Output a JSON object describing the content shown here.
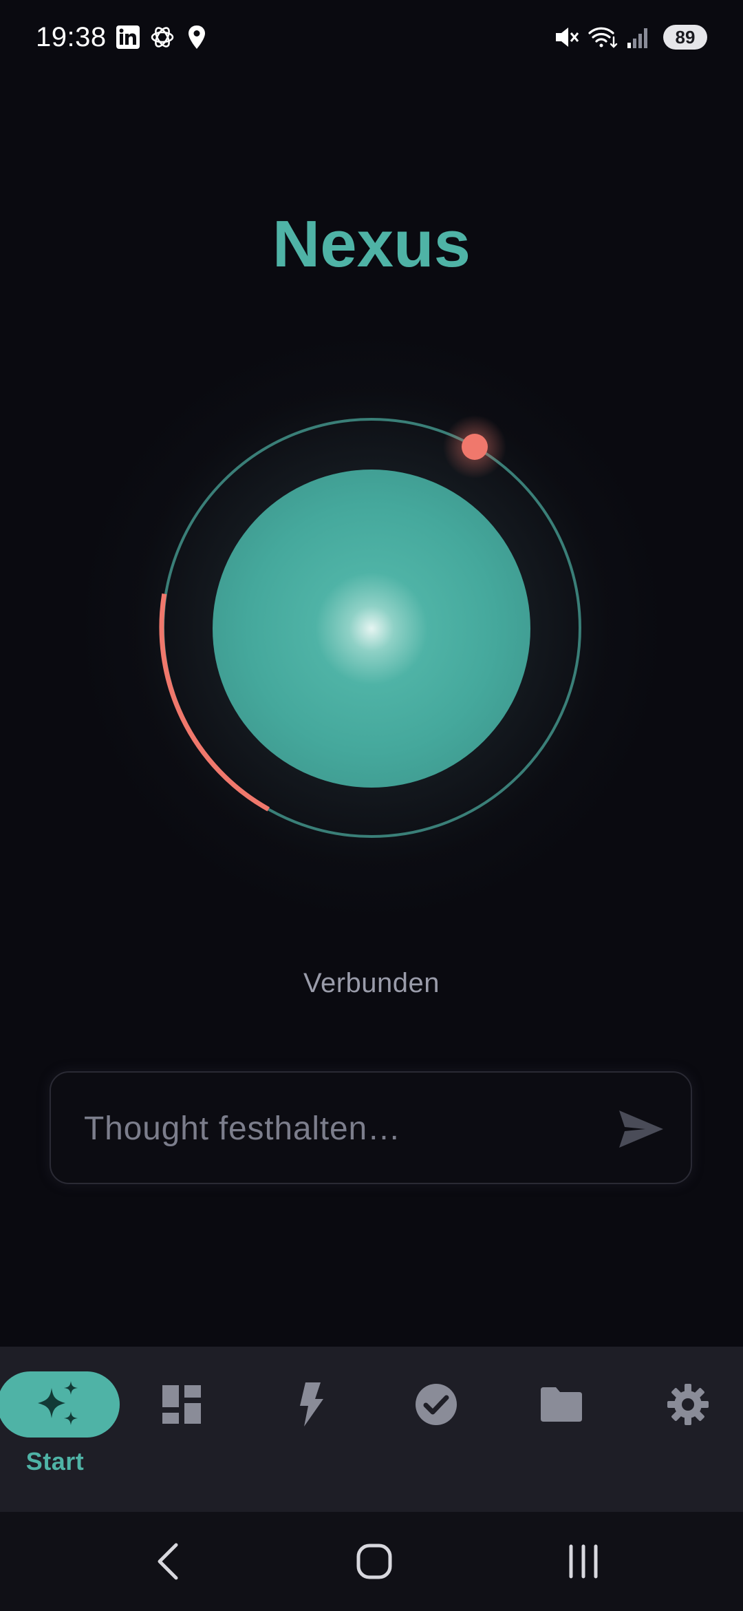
{
  "colors": {
    "accent": "#4fb3a6",
    "alert": "#f0786c",
    "background": "#0a0a10",
    "nav_background": "#1e1e26",
    "muted_text": "#9a9caa",
    "icon_muted": "#8a8c98"
  },
  "status_bar": {
    "time": "19:38",
    "left_icons": [
      "linkedin-icon",
      "openai-icon",
      "location-pin-icon"
    ],
    "right_icons": [
      "mute-icon",
      "wifi-icon",
      "signal-icon"
    ],
    "battery": "89"
  },
  "header": {
    "title": "Nexus"
  },
  "orb": {
    "connection_status": "Verbunden",
    "progress_arc_color": "#f0786c",
    "orbit_color": "#3a8f86"
  },
  "input": {
    "placeholder": "Thought festhalten…",
    "value": "",
    "send_icon": "send-icon"
  },
  "bottom_nav": {
    "items": [
      {
        "label": "Start",
        "icon": "sparkles-icon",
        "active": true
      },
      {
        "label": "",
        "icon": "dashboard-icon",
        "active": false
      },
      {
        "label": "",
        "icon": "lightning-icon",
        "active": false
      },
      {
        "label": "",
        "icon": "check-circle-icon",
        "active": false
      },
      {
        "label": "",
        "icon": "folder-icon",
        "active": false
      },
      {
        "label": "",
        "icon": "settings-icon",
        "active": false
      }
    ]
  },
  "system_nav": {
    "buttons": [
      "back-icon",
      "home-icon",
      "recents-icon"
    ]
  }
}
